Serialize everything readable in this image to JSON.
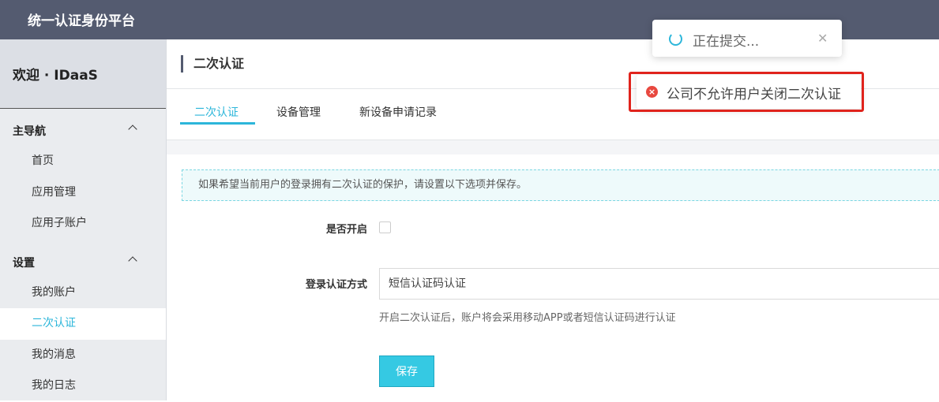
{
  "app": {
    "title": "统一认证身份平台"
  },
  "sidebar": {
    "welcome": "欢迎 · IDaaS",
    "sections": [
      {
        "title": "主导航",
        "items": [
          {
            "label": "首页"
          },
          {
            "label": "应用管理"
          },
          {
            "label": "应用子账户"
          }
        ]
      },
      {
        "title": "设置",
        "items": [
          {
            "label": "我的账户"
          },
          {
            "label": "二次认证"
          },
          {
            "label": "我的消息"
          },
          {
            "label": "我的日志"
          }
        ]
      }
    ],
    "active_item": "二次认证"
  },
  "page": {
    "title": "二次认证",
    "tabs": [
      {
        "label": "二次认证"
      },
      {
        "label": "设备管理"
      },
      {
        "label": "新设备申请记录"
      }
    ],
    "active_tab": "二次认证"
  },
  "form": {
    "info": "如果希望当前用户的登录拥有二次认证的保护，请设置以下选项并保存。",
    "enable_label": "是否开启",
    "enable_checked": false,
    "method_label": "登录认证方式",
    "method_value": "短信认证码认证",
    "hint": "开启二次认证后，账户将会采用移动APP或者短信认证码进行认证",
    "save_label": "保存"
  },
  "toasts": {
    "loading": {
      "text": "正在提交..."
    },
    "error": {
      "text": "公司不允许用户关闭二次认证"
    }
  },
  "colors": {
    "topbar": "#545b70",
    "accent": "#2cb6da",
    "error": "#e0231c",
    "button": "#35c9e3"
  }
}
